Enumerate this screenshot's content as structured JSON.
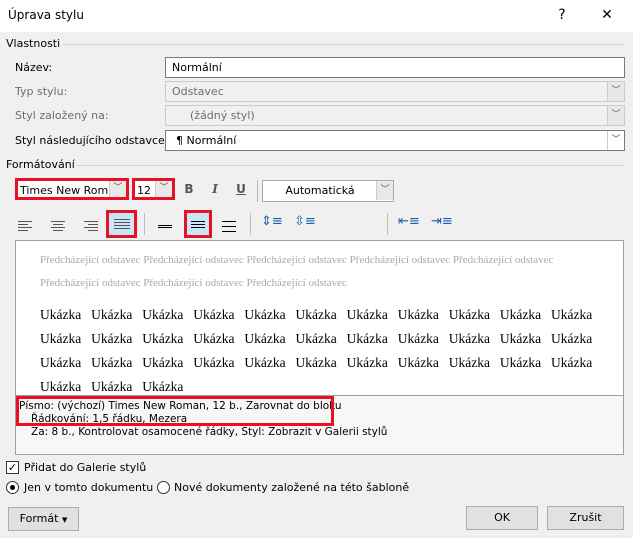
{
  "window": {
    "title": "Úprava stylu",
    "help": "?",
    "close": "✕"
  },
  "properties": {
    "group_label": "Vlastnosti",
    "name_label": "Název:",
    "name_value": "Normální",
    "type_label": "Typ stylu:",
    "type_value": "Odstavec",
    "based_label": "Styl založený na:",
    "based_value": "(žádný styl)",
    "next_label": "Styl následujícího odstavce:",
    "next_value": "¶ Normální"
  },
  "formatting": {
    "group_label": "Formátování",
    "font": "Times New Roman",
    "size": "12",
    "bold": "B",
    "italic": "I",
    "underline": "U",
    "color": "Automatická",
    "highlight_color": "#e81123"
  },
  "preview": {
    "prev_line1": "Předcházející odstavec Předcházející odstavec Předcházející odstavec Předcházející odstavec Předcházející odstavec",
    "prev_line2": "Předcházející odstavec Předcházející odstavec Předcházející odstavec",
    "sample_text": "Ukázka Ukázka Ukázka Ukázka Ukázka Ukázka Ukázka Ukázka Ukázka Ukázka Ukázka Ukázka Ukázka Ukázka Ukázka Ukázka Ukázka Ukázka Ukázka Ukázka Ukázka Ukázka Ukázka Ukázka Ukázka Ukázka Ukázka Ukázka Ukázka Ukázka Ukázka Ukázka Ukázka Ukázka Ukázka Ukázka"
  },
  "description": {
    "line1": "Písmo: (výchozí) Times New Roman, 12 b., Zarovnat do bloku",
    "line2": "Řádkování:  1,5 řádku, Mezera",
    "line3": "Za:  8 b., Kontrolovat osamocené řádky, Styl: Zobrazit v Galerii stylů"
  },
  "options": {
    "add_gallery": "Přidat do Galerie stylů",
    "add_gallery_checked": true,
    "only_doc": "Jen v tomto dokumentu",
    "new_docs": "Nové dokumenty založené na této šabloně",
    "selected": "only_doc"
  },
  "buttons": {
    "format": "Formát",
    "ok": "OK",
    "cancel": "Zrušit"
  }
}
